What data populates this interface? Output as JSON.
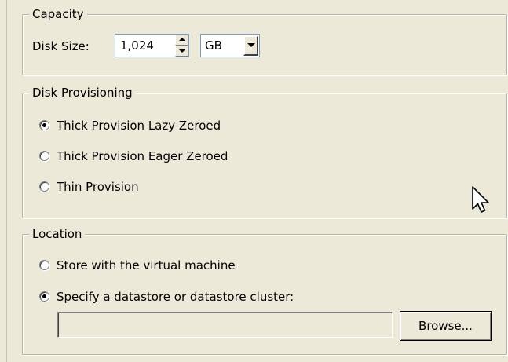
{
  "capacity": {
    "legend": "Capacity",
    "disk_size_label": "Disk Size:",
    "disk_size_value": "1,024",
    "unit": "GB"
  },
  "disk_provisioning": {
    "legend": "Disk Provisioning",
    "options": [
      {
        "label": "Thick Provision Lazy Zeroed",
        "checked": true
      },
      {
        "label": "Thick Provision Eager Zeroed",
        "checked": false
      },
      {
        "label": "Thin Provision",
        "checked": false
      }
    ]
  },
  "location": {
    "legend": "Location",
    "options": [
      {
        "label": "Store with the virtual machine",
        "checked": false
      },
      {
        "label": "Specify a datastore or datastore cluster:",
        "checked": true
      }
    ],
    "datastore_value": "",
    "browse_label": "Browse..."
  },
  "icons": {
    "spin_up": "chevron-up-icon",
    "spin_down": "chevron-down-icon",
    "combo": "dropdown-arrow-icon",
    "cursor": "mouse-pointer-icon"
  }
}
